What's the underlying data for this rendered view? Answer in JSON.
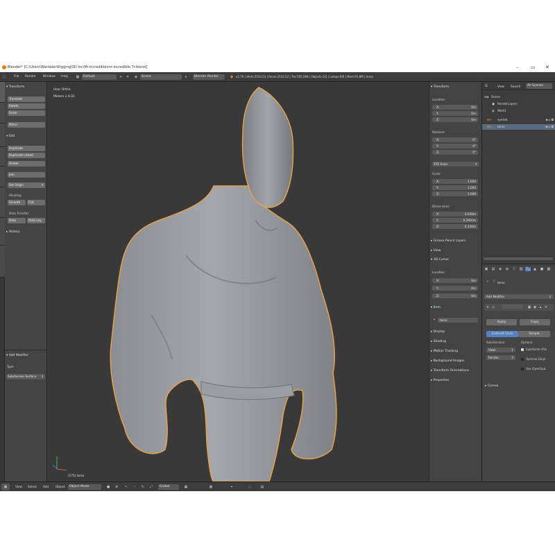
{
  "window": {
    "title": "Blender* [C:\\Users\\Wardaler\\Rigging\\3D Inc\\Mr.incredible\\mr-incredible 7r.blend]",
    "controls": [
      "–",
      "▭",
      "✕"
    ]
  },
  "topbar": {
    "menus": [
      "File",
      "Render",
      "Window",
      "Help"
    ],
    "layout": "Default",
    "scene": "Scene",
    "engine": "Blender Render",
    "stats": "v2.79 | Verts:2533.53 | Faces:2533.52 | Tris:505.068 | Objects:1/2 | Lamps:0/0 | Mem:91.8M | torso"
  },
  "toolshelf": {
    "transform_title": "Transform",
    "transform_buttons": [
      "Translate",
      "Rotate",
      "Scale",
      "Mirror"
    ],
    "edit_title": "Edit",
    "edit_buttons": [
      "Duplicate",
      "Duplicate Linked",
      "Delete",
      "Join"
    ],
    "set_origin": "Set Origin",
    "shading_label": "Shading:",
    "shading_smooth": "Smooth",
    "shading_flat": "Flat",
    "data_transfer_label": "Data Transfer:",
    "data_btn": "Data",
    "data_layout_btn": "Data Lay.",
    "history_title": "History",
    "add_modifier_title": "Add Modifier",
    "type_label": "Type",
    "type_value": "Subdivision Surface"
  },
  "viewport": {
    "view_name": "User Ortho",
    "meters": "Meters x 0.01",
    "object_label": "(175) torso"
  },
  "npanel": {
    "transform_title": "Transform",
    "location_label": "Location:",
    "location": [
      {
        "axis": "X:",
        "value": "0m"
      },
      {
        "axis": "Y:",
        "value": "0m"
      },
      {
        "axis": "Z:",
        "value": "0m"
      }
    ],
    "rotation_label": "Rotation:",
    "rotation": [
      {
        "axis": "X:",
        "value": "0°"
      },
      {
        "axis": "Y:",
        "value": "0°"
      },
      {
        "axis": "Z:",
        "value": "0°"
      }
    ],
    "rotation_mode": "XYZ Euler",
    "scale_label": "Scale:",
    "scale": [
      {
        "axis": "X:",
        "value": "1.000"
      },
      {
        "axis": "Y:",
        "value": "1.000"
      },
      {
        "axis": "Z:",
        "value": "1.000"
      }
    ],
    "dimensions_label": "Dimensions:",
    "dimensions": [
      {
        "axis": "X:",
        "value": "4.038m"
      },
      {
        "axis": "Y:",
        "value": "6.260cm"
      },
      {
        "axis": "Z:",
        "value": "6.320m"
      }
    ],
    "grease_pencil": "Grease Pencil Layers",
    "view": "View",
    "cursor_title": "3D Cursor",
    "cursor_location_label": "Location:",
    "cursor": [
      {
        "axis": "X:",
        "value": "0m"
      },
      {
        "axis": "Y:",
        "value": "0m"
      },
      {
        "axis": "Z:",
        "value": "0m"
      }
    ],
    "item_title": "Item",
    "item_name": "torso",
    "display": "Display",
    "shading": "Shading",
    "motion_tracking": "Motion Tracking",
    "background_images": "Background Images",
    "transform_orientations": "Transform Orientations",
    "properties": "Properties"
  },
  "outliner": {
    "view": "View",
    "search": "Search",
    "filter": "All Scenes",
    "rows": [
      "Scene",
      "RenderLayers",
      "World",
      "eyelids",
      "torso"
    ]
  },
  "props": {
    "object_name": "torso",
    "add_modifier": "Add Modifier",
    "apply": "Apply",
    "copy": "Copy",
    "catmull": "Catmull-Clark",
    "simple": "Simple",
    "subdivisions_label": "Subdivisions:",
    "options_label": "Options:",
    "view_label": "View:",
    "view_value": "1",
    "render_label": "Render:",
    "render_value": "2",
    "subdivide_uvs": "Subdivide UVs",
    "optimal_display": "Optimal Displ.",
    "use_opensubdiv": "Use OpenSub.",
    "curves": "Curves"
  },
  "bottombar": {
    "menus": [
      "View",
      "Select",
      "Add",
      "Object"
    ],
    "mode": "Object Mode",
    "orientation": "Global"
  },
  "colors": {
    "selected": "#e8a04a",
    "active_button": "#5680c2",
    "background": "#393939"
  }
}
